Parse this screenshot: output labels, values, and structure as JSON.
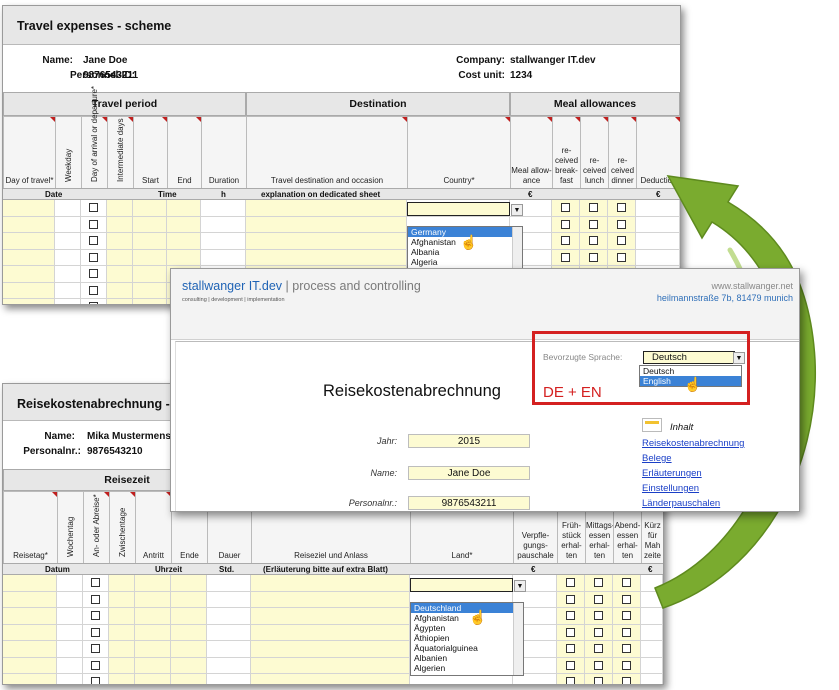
{
  "en": {
    "title": "Travel expenses - scheme",
    "name_label": "Name:",
    "name_value": "Jane Doe",
    "pid_label": "Personnel-ID:",
    "pid_value": "9876543211",
    "company_label": "Company:",
    "company_value": "stallwanger IT.dev",
    "costunit_label": "Cost unit:",
    "costunit_value": "1234",
    "group_travel_period": "Travel period",
    "group_destination": "Destination",
    "group_meal": "Meal allowances",
    "cols": {
      "day_of_travel": "Day of travel*",
      "weekday": "Weekday",
      "arrival_departure": "Day of arrival or departure*",
      "intermediate": "Intermediate days",
      "start": "Start",
      "end": "End",
      "duration": "Duration",
      "destination": "Travel destination and occasion",
      "country": "Country*",
      "meal_allowance": "Meal allow-ance",
      "breakfast": "re-ceived break-fast",
      "lunch": "re-ceived lunch",
      "dinner": "re-ceived dinner",
      "deduction": "Deduction"
    },
    "units": {
      "date": "Date",
      "time": "Time",
      "h": "h",
      "expl": "explanation on dedicated sheet",
      "eur1": "€",
      "eur2": "€"
    },
    "country_options": [
      "Germany",
      "Afghanistan",
      "Albania",
      "Algeria"
    ],
    "country_selected": "Germany"
  },
  "form": {
    "brand_name": "stallwanger IT.dev",
    "brand_rest": " | process and controlling",
    "tagline": "consulting | development | implementation",
    "web": "www.stallwanger.net",
    "address": "heilmannstraße 7b, 81479 munich",
    "lang_label": "Bevorzugte Sprache:",
    "lang_value": "Deutsch",
    "lang_options": [
      "Deutsch",
      "English"
    ],
    "lang_highlighted": "English",
    "heading": "Reisekostenabrechnung",
    "annotation": "DE + EN",
    "jahr_label": "Jahr:",
    "jahr_value": "2015",
    "name_label": "Name:",
    "name_value": "Jane Doe",
    "pnr_label": "Personalnr.:",
    "pnr_value": "9876543211",
    "toc_title": "Inhalt",
    "toc_links": [
      "Reisekostenabrechnung",
      "Belege",
      "Erläuterungen",
      "Einstellungen",
      "Länderpauschalen"
    ]
  },
  "de": {
    "title": "Reisekostenabrechnung -",
    "name_label": "Name:",
    "name_value": "Mika Mustermens",
    "pnr_label": "Personalnr.:",
    "pnr_value": "9876543210",
    "group_reisezeit": "Reisezeit",
    "cols": {
      "reisetag": "Reisetag*",
      "wochentag": "Wochentag",
      "an_abreise": "An- oder Abreise*",
      "zwischentage": "Zwischentage",
      "antritt": "Antritt",
      "ende": "Ende",
      "dauer": "Dauer",
      "reiseziel": "Reiseziel und Anlass",
      "land": "Land*",
      "verpflegung": "Verpfle-gungs-pauschale",
      "fruehstueck": "Früh-stück erhal-ten",
      "mittag": "Mittags-essen erhal-ten",
      "abend": "Abend-essen erhal-ten",
      "kuerzung": "Kürz für Mah zeite"
    },
    "units": {
      "datum": "Datum",
      "uhrzeit": "Uhrzeit",
      "std": "Std.",
      "erl": "(Erläuterung bitte auf extra Blatt)",
      "eur1": "€",
      "eur2": "€"
    },
    "country_options": [
      "Deutschland",
      "Afghanistan",
      "Ägypten",
      "Äthiopien",
      "Äquatorialguinea",
      "Albanien",
      "Algerien"
    ],
    "country_selected": "Deutschland"
  },
  "colors": {
    "accent_green": "#7aab2f",
    "annotation_red": "#d42020",
    "highlight_blue": "#3b82d6",
    "input_yellow": "#fdfbd2"
  }
}
